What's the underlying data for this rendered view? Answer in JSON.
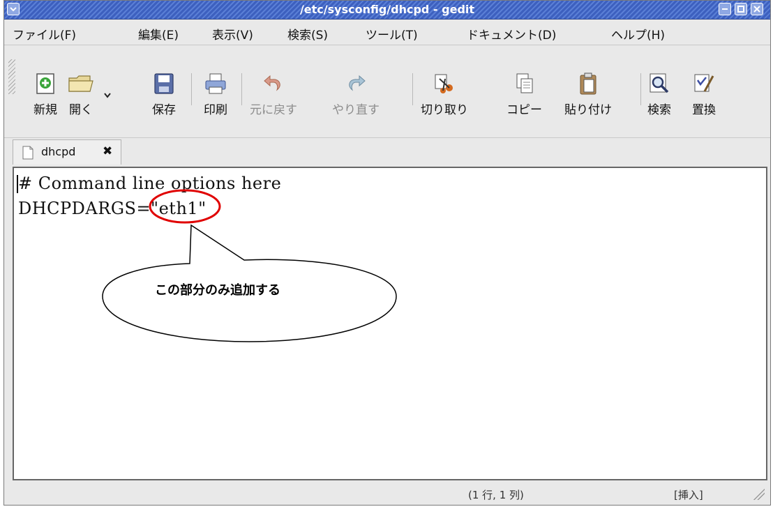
{
  "window": {
    "title": "/etc/sysconfig/dhcpd - gedit",
    "titlebar_color": "#4a6fd0"
  },
  "menubar": {
    "items": [
      "ファイル(F)",
      "編集(E)",
      "表示(V)",
      "検索(S)",
      "ツール(T)",
      "ドキュメント(D)",
      "ヘルプ(H)"
    ]
  },
  "toolbar": {
    "new": "新規",
    "open": "開く",
    "save": "保存",
    "print": "印刷",
    "undo": "元に戻す",
    "redo": "やり直す",
    "cut": "切り取り",
    "copy": "コピー",
    "paste": "貼り付け",
    "find": "検索",
    "replace": "置換"
  },
  "tabs": [
    {
      "label": "dhcpd"
    }
  ],
  "editor": {
    "lines": [
      "# Command line options here",
      "DHCPDARGS=\"eth1\""
    ]
  },
  "annotation": {
    "callout_text": "この部分のみ追加する",
    "highlight_color": "#e00000"
  },
  "statusbar": {
    "position": "(1 行, 1 列)",
    "mode": "[挿入]"
  }
}
